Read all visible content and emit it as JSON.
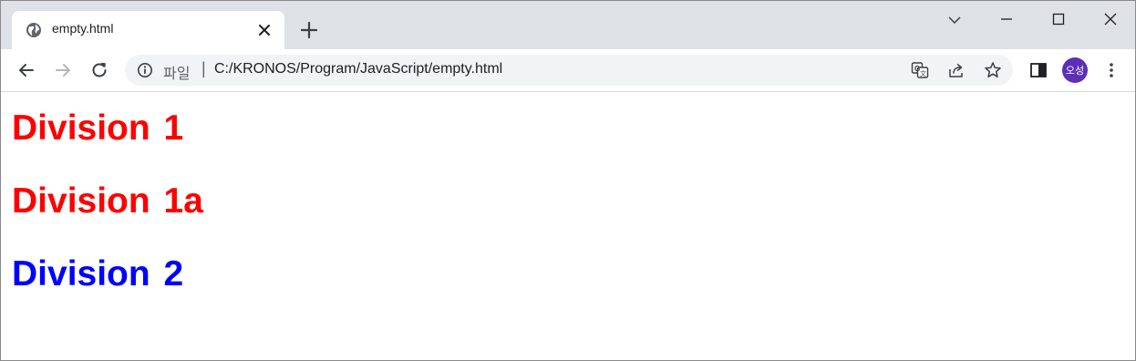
{
  "browser": {
    "tab": {
      "title": "empty.html",
      "favicon": "globe-icon"
    },
    "address_bar": {
      "scheme_label": "파일",
      "separator": "|",
      "url": "C:/KRONOS/Program/JavaScript/empty.html"
    },
    "profile_initials": "오성"
  },
  "page": {
    "headings": [
      {
        "text": "Division 1",
        "color": "#ff0000"
      },
      {
        "text": "Division 1a",
        "color": "#ff0000"
      },
      {
        "text": "Division 2",
        "color": "#0000ff"
      }
    ]
  },
  "colors": {
    "tabstrip": "#dee1e6",
    "omnibox": "#f1f3f4",
    "avatar": "#5c2fb8"
  }
}
